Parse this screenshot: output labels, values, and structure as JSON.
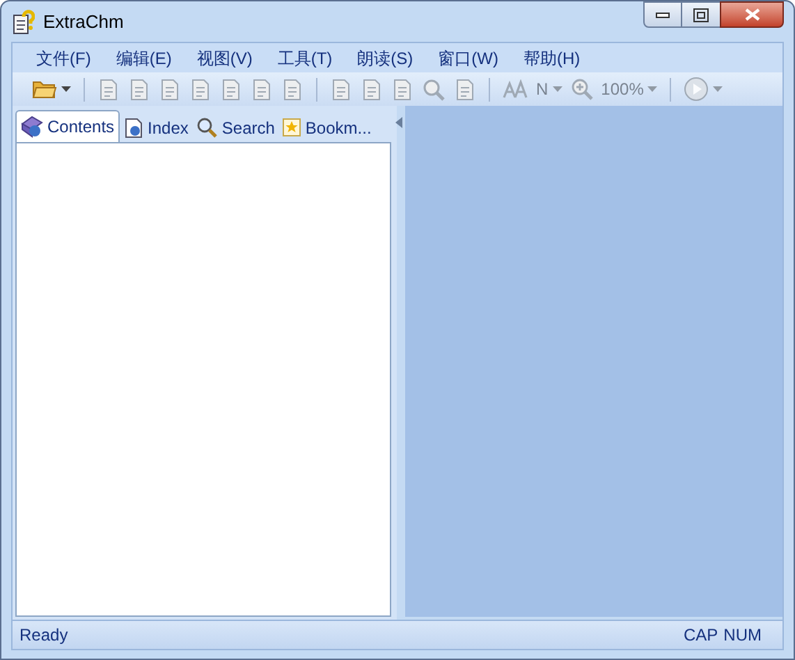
{
  "window": {
    "title": "ExtraChm"
  },
  "menu": [
    "文件(F)",
    "编辑(E)",
    "视图(V)",
    "工具(T)",
    "朗读(S)",
    "窗口(W)",
    "帮助(H)"
  ],
  "toolbar": [
    {
      "kind": "folder",
      "disabled": false,
      "dropdown": true
    },
    {
      "kind": "separator"
    },
    {
      "kind": "page",
      "disabled": true
    },
    {
      "kind": "page",
      "disabled": true
    },
    {
      "kind": "page",
      "disabled": true
    },
    {
      "kind": "page",
      "disabled": true
    },
    {
      "kind": "page",
      "disabled": true
    },
    {
      "kind": "page",
      "disabled": true
    },
    {
      "kind": "page",
      "disabled": true
    },
    {
      "kind": "separator"
    },
    {
      "kind": "page",
      "disabled": true
    },
    {
      "kind": "page",
      "disabled": true
    },
    {
      "kind": "page",
      "disabled": true
    },
    {
      "kind": "search",
      "disabled": true
    },
    {
      "kind": "page",
      "disabled": true
    },
    {
      "kind": "separator"
    },
    {
      "kind": "font",
      "disabled": true
    },
    {
      "kind": "text",
      "text": "N",
      "disabled": true,
      "dropdown": true
    },
    {
      "kind": "zoom",
      "disabled": true
    },
    {
      "kind": "text",
      "text": "100%",
      "disabled": true,
      "dropdown": true
    },
    {
      "kind": "separator"
    },
    {
      "kind": "play",
      "disabled": true,
      "dropdown": true
    }
  ],
  "tabs": [
    {
      "label": "Contents",
      "selected": true,
      "kind": "book"
    },
    {
      "label": "Index",
      "selected": false,
      "kind": "page"
    },
    {
      "label": "Search",
      "selected": false,
      "kind": "search"
    },
    {
      "label": "Bookm...",
      "selected": false,
      "kind": "star"
    }
  ],
  "status_bar": {
    "text": "Ready",
    "indicators": [
      "CAP",
      "NUM"
    ]
  }
}
